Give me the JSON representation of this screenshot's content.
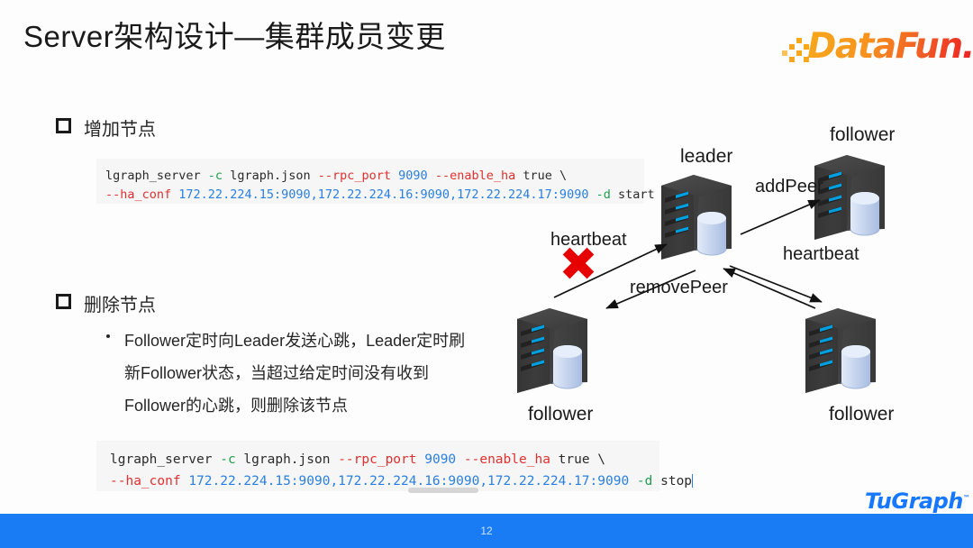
{
  "slide": {
    "title": "Server架构设计—集群成员变更",
    "page_number": "12",
    "background_color": "#fdfdfd",
    "footer_color": "#1a7cf5"
  },
  "brand": {
    "datafun_logo_text": "DataFun.",
    "datafun_icon": "pixel-dots-icon",
    "tugraph_logo_text": "TuGraph",
    "tugraph_tm": "™",
    "tugraph_color": "#1677ff"
  },
  "sections": {
    "add_node": {
      "bullet_label": "增加节点",
      "bullet_icon": "hollow-square-bullet"
    },
    "delete_node": {
      "bullet_label": "删除节点",
      "bullet_icon": "hollow-square-bullet",
      "sub_bullet_icon": "round-dot-bullet",
      "sub_lines": [
        "Follower定时向Leader发送心跳，Leader定时刷",
        "新Follower状态，当超过给定时间没有收到",
        "Follower的心跳，则删除该节点"
      ]
    }
  },
  "code_blocks": [
    {
      "id": "start-command",
      "lines": [
        [
          {
            "t": "lgraph_server ",
            "c": "plain"
          },
          {
            "t": "-c",
            "c": "green"
          },
          {
            "t": " lgraph.json ",
            "c": "plain"
          },
          {
            "t": "--rpc_port",
            "c": "red"
          },
          {
            "t": " ",
            "c": "plain"
          },
          {
            "t": "9090",
            "c": "blue"
          },
          {
            "t": " ",
            "c": "plain"
          },
          {
            "t": "--enable_ha",
            "c": "red"
          },
          {
            "t": " true \\",
            "c": "plain"
          }
        ],
        [
          {
            "t": "--ha_conf",
            "c": "red"
          },
          {
            "t": " ",
            "c": "plain"
          },
          {
            "t": "172.22.224.15:9090,172.22.224.16:9090,172.22.224.17:9090",
            "c": "blue"
          },
          {
            "t": " ",
            "c": "plain"
          },
          {
            "t": "-d",
            "c": "green"
          },
          {
            "t": " start",
            "c": "plain"
          }
        ]
      ]
    },
    {
      "id": "stop-command",
      "lines": [
        [
          {
            "t": "lgraph_server ",
            "c": "plain"
          },
          {
            "t": "-c",
            "c": "green"
          },
          {
            "t": " lgraph.json ",
            "c": "plain"
          },
          {
            "t": "--rpc_port",
            "c": "red"
          },
          {
            "t": " ",
            "c": "plain"
          },
          {
            "t": "9090",
            "c": "blue"
          },
          {
            "t": " ",
            "c": "plain"
          },
          {
            "t": "--enable_ha",
            "c": "red"
          },
          {
            "t": " true \\",
            "c": "plain"
          }
        ],
        [
          {
            "t": "--ha_conf",
            "c": "red"
          },
          {
            "t": " ",
            "c": "plain"
          },
          {
            "t": "172.22.224.15:9090,172.22.224.16:9090,172.22.224.17:9090",
            "c": "blue"
          },
          {
            "t": " ",
            "c": "plain"
          },
          {
            "t": "-d",
            "c": "green"
          },
          {
            "t": " stop",
            "c": "plain"
          }
        ]
      ],
      "has_text_caret": true
    }
  ],
  "diagram": {
    "nodes": [
      {
        "id": "leader",
        "label": "leader",
        "role": "leader"
      },
      {
        "id": "follower-tr",
        "label": "follower",
        "role": "follower"
      },
      {
        "id": "follower-bl",
        "label": "follower",
        "role": "follower"
      },
      {
        "id": "follower-br",
        "label": "follower",
        "role": "follower"
      }
    ],
    "edges": [
      {
        "id": "addpeer",
        "label": "addPeer",
        "from": "leader",
        "to": "follower-tr"
      },
      {
        "id": "removepeer",
        "label": "removePeer",
        "from": "leader",
        "to": "follower-bl"
      },
      {
        "id": "heartbeat-1",
        "label": "heartbeat",
        "from": "follower-bl",
        "to": "leader",
        "blocked": true
      },
      {
        "id": "heartbeat-2",
        "label": "heartbeat",
        "from": "follower-br",
        "to": "leader"
      }
    ],
    "blocked_marker": {
      "icon": "red-x-icon",
      "color": "#e60000"
    },
    "server_colors": {
      "body": "#3d3d3d",
      "led": "#00a0e0",
      "disk": "#c3d2ec"
    }
  }
}
